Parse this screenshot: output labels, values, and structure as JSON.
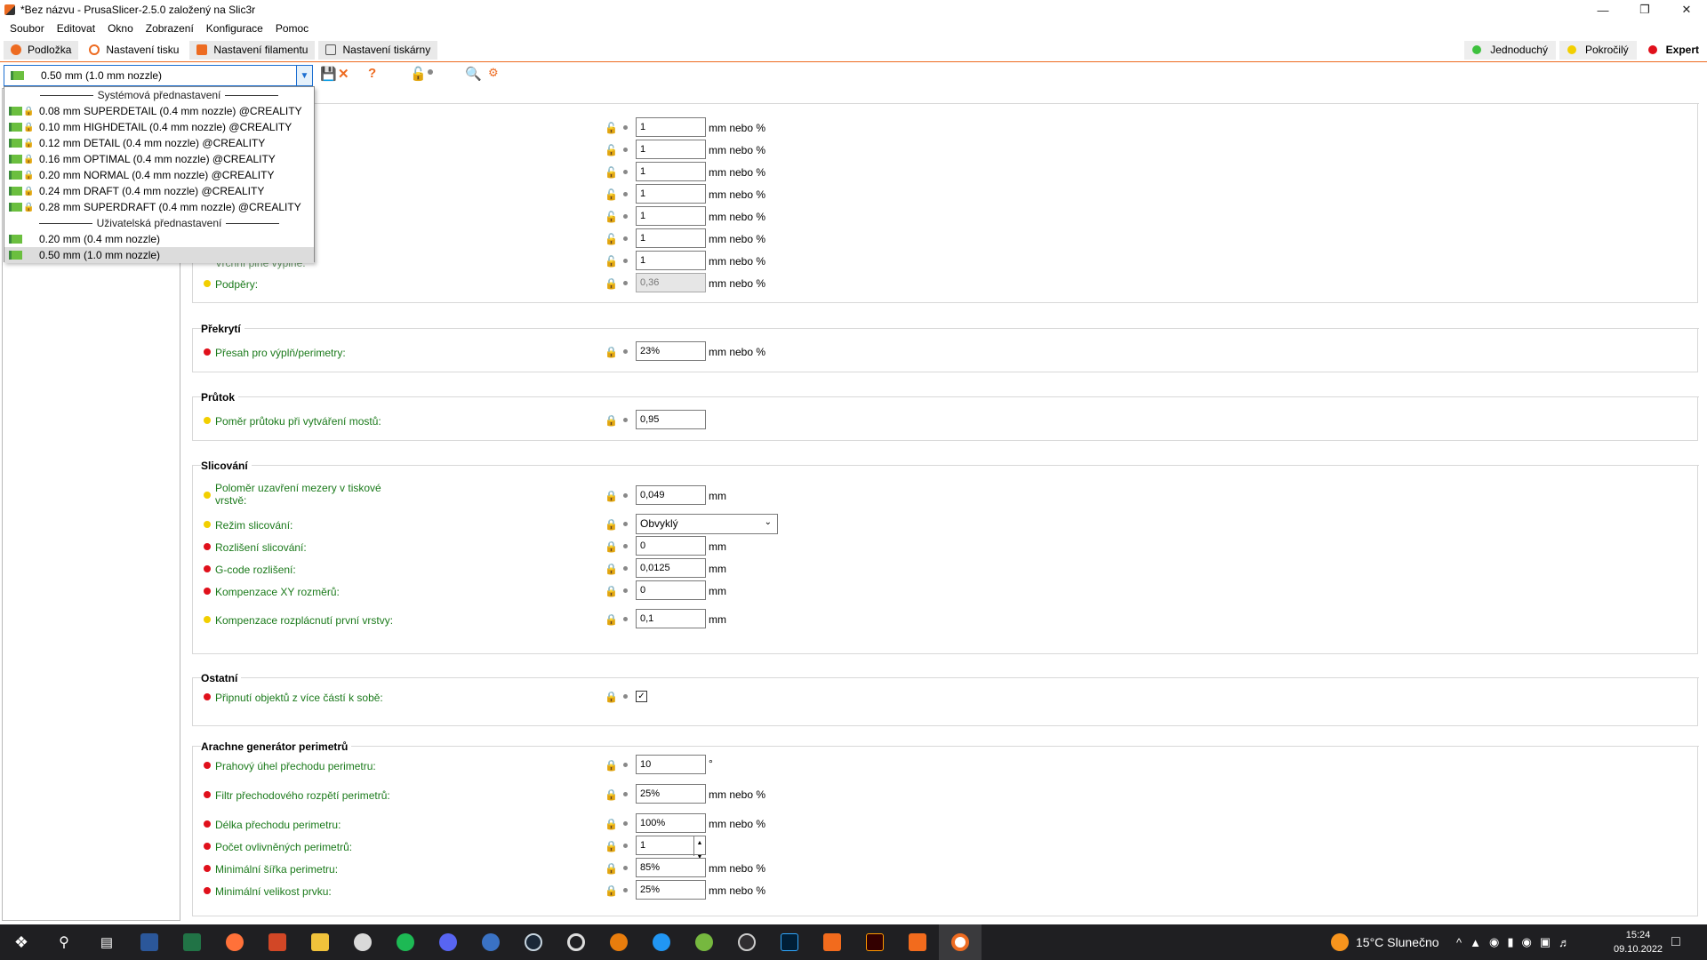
{
  "window": {
    "title": "*Bez názvu - PrusaSlicer-2.5.0 založený na Slic3r",
    "minimize": "—",
    "maximize": "❐",
    "close": "✕"
  },
  "menu": [
    "Soubor",
    "Editovat",
    "Okno",
    "Zobrazení",
    "Konfigurace",
    "Pomoc"
  ],
  "tabs": [
    {
      "label": "Podložka",
      "color": "#ed6b21"
    },
    {
      "label": "Nastavení tisku",
      "color": "#ed6b21"
    },
    {
      "label": "Nastavení filamentu",
      "color": "#ed6b21"
    },
    {
      "label": "Nastavení tiskárny",
      "color": "#555555"
    }
  ],
  "modes": [
    {
      "label": "Jednoduchý",
      "color": "#3ec13e"
    },
    {
      "label": "Pokročilý",
      "color": "#f2cf00"
    },
    {
      "label": "Expert",
      "color": "#e0101b"
    }
  ],
  "preset": {
    "selected": "0.50 mm (1.0 mm nozzle)",
    "dropdown": {
      "system_header": "Systémová přednastavení",
      "system_items": [
        "0.08 mm SUPERDETAIL (0.4 mm nozzle) @CREALITY",
        "0.10 mm HIGHDETAIL (0.4 mm nozzle) @CREALITY",
        "0.12 mm DETAIL (0.4 mm nozzle) @CREALITY",
        "0.16 mm OPTIMAL (0.4 mm nozzle) @CREALITY",
        "0.20 mm NORMAL (0.4 mm nozzle) @CREALITY",
        "0.24 mm DRAFT (0.4 mm nozzle) @CREALITY",
        "0.28 mm SUPERDRAFT (0.4 mm nozzle) @CREALITY"
      ],
      "user_header": "Uživatelská přednastavení",
      "user_items": [
        "0.20 mm (0.4 mm nozzle)",
        "0.50 mm (1.0 mm nozzle)"
      ]
    }
  },
  "top_group": {
    "rows": [
      {
        "value": "1",
        "unit": "mm nebo %"
      },
      {
        "value": "1",
        "unit": "mm nebo %"
      },
      {
        "value": "1",
        "unit": "mm nebo %"
      },
      {
        "value": "1",
        "unit": "mm nebo %"
      },
      {
        "value": "1",
        "unit": "mm nebo %"
      },
      {
        "value": "1",
        "unit": "mm nebo %"
      },
      {
        "value": "1",
        "unit": "mm nebo %"
      }
    ],
    "partial_label": "Vrchní plné výplně:",
    "supports_label": "Podpěry:",
    "supports_value": "0,36",
    "supports_unit": "mm nebo %"
  },
  "overlap": {
    "title": "Překrytí",
    "label": "Přesah pro výplň/perimetry:",
    "value": "23%",
    "unit": "mm nebo %"
  },
  "flow": {
    "title": "Průtok",
    "label": "Poměr průtoku při vytváření mostů:",
    "value": "0,95"
  },
  "slicing": {
    "title": "Slicování",
    "gap_label_1": "Poloměr uzavření mezery v tiskové",
    "gap_label_2": "vrstvě:",
    "gap_value": "0,049",
    "gap_unit": "mm",
    "mode_label": "Režim slicování:",
    "mode_value": "Obvyklý",
    "res_label": "Rozlišení slicování:",
    "res_value": "0",
    "res_unit": "mm",
    "gcode_label": "G-code rozlišení:",
    "gcode_value": "0,0125",
    "gcode_unit": "mm",
    "xy_label": "Kompenzace XY rozměrů:",
    "xy_value": "0",
    "xy_unit": "mm",
    "elephant_label": "Kompenzace rozplácnutí první vrstvy:",
    "elephant_value": "0,1",
    "elephant_unit": "mm"
  },
  "other": {
    "title": "Ostatní",
    "label": "Připnutí objektů z více částí k sobě:",
    "checked": "✓"
  },
  "arachne": {
    "title": "Arachne generátor perimetrů",
    "angle_label": "Prahový úhel přechodu perimetru:",
    "angle_value": "10",
    "angle_unit": "°",
    "filter_label": "Filtr přechodového rozpětí perimetrů:",
    "filter_value": "25%",
    "filter_unit": "mm nebo %",
    "length_label": "Délka přechodu perimetru:",
    "length_value": "100%",
    "length_unit": "mm nebo %",
    "count_label": "Počet ovlivněných perimetrů:",
    "count_value": "1",
    "minwidth_label": "Minimální šířka perimetru:",
    "minwidth_value": "85%",
    "minwidth_unit": "mm nebo %",
    "minfeat_label": "Minimální velikost prvku:",
    "minfeat_value": "25%",
    "minfeat_unit": "mm nebo %"
  },
  "colors": {
    "simple": "#f2cf00",
    "expert": "#e0101b",
    "accent": "#ed6b21",
    "label_green": "#1b7a1b"
  },
  "taskbar": {
    "weather_temp": "15°C",
    "weather_text": "Slunečno",
    "time": "15:24",
    "date": "09.10.2022"
  }
}
